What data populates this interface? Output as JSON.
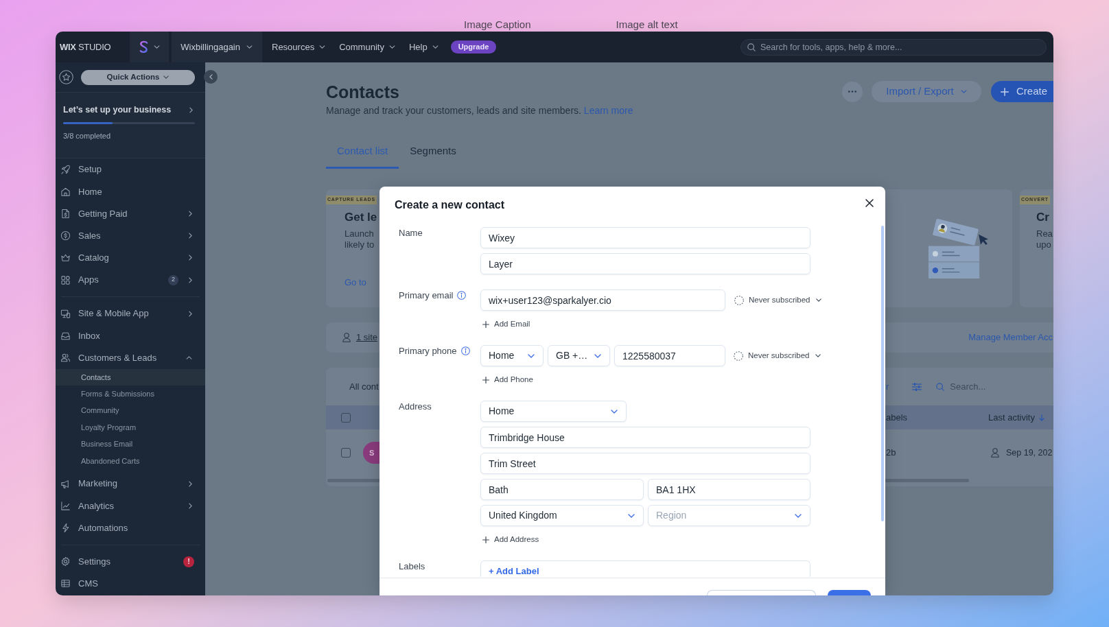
{
  "background_labels": [
    "Image Caption",
    "Image alt text"
  ],
  "top_bar": {
    "logo": "**WIX** STUDIO",
    "site_name": "Wixbillingagain",
    "menus": [
      {
        "label": "Resources"
      },
      {
        "label": "Community"
      },
      {
        "label": "Help"
      }
    ],
    "upgrade": "Upgrade",
    "search": {
      "placeholder": "Search for tools, apps, help & more..."
    }
  },
  "sidebar": {
    "quick_actions": "Quick Actions",
    "setup": {
      "title": "Let’s set up your business",
      "level": 0.375,
      "progress": "3/8 completed"
    },
    "groups": [
      {
        "items": [
          {
            "label": "Setup",
            "kind": "link"
          },
          {
            "label": "Home",
            "kind": "link"
          },
          {
            "label": "Getting Paid",
            "kind": "menu",
            "expanded": false
          },
          {
            "label": "Sales",
            "kind": "menu",
            "expanded": false
          },
          {
            "label": "Catalog",
            "kind": "menu",
            "expanded": false
          },
          {
            "label": "Apps",
            "kind": "menu",
            "expanded": false,
            "badge": "2"
          }
        ]
      },
      {
        "items": [
          {
            "label": "Site & Mobile App",
            "kind": "menu",
            "expanded": false
          },
          {
            "label": "Inbox",
            "kind": "link"
          },
          {
            "label": "Customers & Leads",
            "kind": "menu",
            "expanded": true,
            "children": [
              {
                "label": "Contacts",
                "selected": true
              },
              {
                "label": "Forms & Submissions",
                "selected": false
              },
              {
                "label": "Community",
                "selected": false
              },
              {
                "label": "Loyalty Program",
                "selected": false
              },
              {
                "label": "Business Email",
                "selected": false
              },
              {
                "label": "Abandoned Carts",
                "selected": false
              }
            ]
          },
          {
            "label": "Marketing",
            "kind": "menu",
            "expanded": false
          },
          {
            "label": "Analytics",
            "kind": "menu",
            "expanded": false
          },
          {
            "label": "Automations",
            "kind": "link"
          }
        ]
      },
      {
        "items": [
          {
            "label": "Settings",
            "kind": "link",
            "alert": "!"
          },
          {
            "label": "CMS",
            "kind": "link"
          }
        ]
      }
    ]
  },
  "page": {
    "title": "Contacts",
    "subtitle": "Manage and track your customers, leads and site members.",
    "learn_more": "Learn more",
    "import_export": "Import / Export",
    "create": "Create"
  },
  "tabs": [
    {
      "label": "Contact list",
      "selected": true
    },
    {
      "label": "Segments",
      "selected": false
    }
  ],
  "cards": [
    {
      "kind": "illustrated",
      "tag": "CAPTURE LEADS",
      "title": "Get le",
      "text": [
        "Launch",
        "likely to"
      ],
      "link": "Go to"
    },
    {
      "kind": "plain",
      "tag": "CONVERT",
      "title": "Cr",
      "text": [
        "Rea",
        "upo"
      ]
    }
  ],
  "member_banner": {
    "link": "1 site",
    "action": "Manage Member Acc"
  },
  "table": {
    "filter": "All cont",
    "toolbar_link": "r",
    "search": {
      "placeholder": "Search..."
    },
    "header": {
      "checked": false,
      "columns": [
        {
          "label": "abels",
          "sorted": false
        },
        {
          "label": "Last activity",
          "sorted": true
        }
      ]
    },
    "rows": [
      {
        "checked": false,
        "avatar": "S",
        "labels": "2b",
        "last_activity": "Sep 19, 202"
      }
    ]
  },
  "dialog": {
    "title": "Create a new contact",
    "rows": [
      {
        "kind": "name",
        "label": "Name",
        "info": false,
        "first": "Wixey",
        "last": "Layer"
      },
      {
        "kind": "email",
        "label": "Primary email",
        "info": true,
        "value": "wix+user123@sparkalyer.cio",
        "subscription": "Never subscribed",
        "add": "Add Email"
      },
      {
        "kind": "phone",
        "label": "Primary phone",
        "info": true,
        "type": "Home",
        "country": "GB +…",
        "value": "1225580037",
        "subscription": "Never subscribed",
        "add": "Add Phone"
      },
      {
        "kind": "address",
        "label": "Address",
        "info": false,
        "type": "Home",
        "street": "Trimbridge House",
        "street2": "Trim Street",
        "city": "Bath",
        "postcode": "BA1 1HX",
        "country": "United Kingdom",
        "region": {
          "placeholder": "Region"
        },
        "add": "Add Address"
      },
      {
        "kind": "labels",
        "label": "Labels",
        "info": false,
        "add": "+ Add Label"
      }
    ]
  }
}
